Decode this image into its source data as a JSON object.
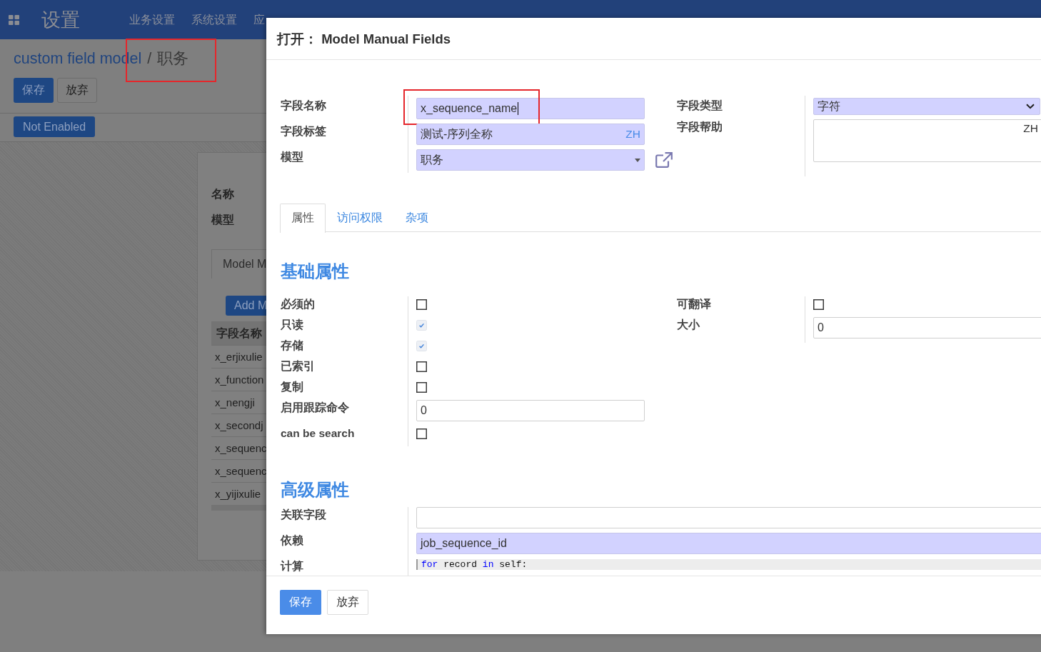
{
  "topbar": {
    "brand": "设置",
    "menu": [
      "业务设置",
      "系统设置",
      "应"
    ]
  },
  "background_page": {
    "breadcrumb": [
      {
        "label": "custom field model",
        "link": true,
        "highlighted": false
      },
      {
        "label": "职务",
        "link": false,
        "highlighted": true
      }
    ],
    "breadcrumb_separator": "/",
    "buttons": [
      {
        "label": "保存",
        "kind": "primary"
      },
      {
        "label": "放弃",
        "kind": "secondary"
      }
    ],
    "status_button": "Not Enabled",
    "sheet": {
      "fields": [
        "名称",
        "模型"
      ],
      "tabs": [
        {
          "label": "Model M",
          "selected": true
        }
      ],
      "add_button": "Add M",
      "table": {
        "columns": [
          "字段名称"
        ],
        "rows": [
          [
            "x_erjixulie"
          ],
          [
            "x_function"
          ],
          [
            "x_nengji"
          ],
          [
            "x_secondj"
          ],
          [
            "x_sequenc"
          ],
          [
            "x_sequenc"
          ],
          [
            "x_yijixulie"
          ]
        ]
      }
    }
  },
  "dialog": {
    "title": "打开： Model Manual Fields",
    "header_fields": {
      "left": [
        {
          "label": "字段名称",
          "kind": "text",
          "value": "x_sequence_name",
          "required": true,
          "focused": true,
          "highlighted": true
        },
        {
          "label": "字段标签",
          "kind": "translatable",
          "value": "测试-序列全称",
          "lang": "ZH",
          "required": true,
          "focused": false,
          "highlighted": false
        },
        {
          "label": "模型",
          "kind": "many2one",
          "value": "职务",
          "required": true,
          "focused": false,
          "highlighted": false
        }
      ],
      "right": [
        {
          "label": "字段类型",
          "kind": "select",
          "value": "字符",
          "required": true
        },
        {
          "label": "字段帮助",
          "kind": "textarea",
          "lang": "ZH",
          "required": false
        }
      ]
    },
    "tabs": [
      {
        "label": "属性",
        "selected": true
      },
      {
        "label": "访问权限",
        "selected": false
      },
      {
        "label": "杂项",
        "selected": false
      }
    ],
    "basic": {
      "title": "基础属性",
      "left": [
        {
          "label": "必须的",
          "kind": "checkbox",
          "checked": false
        },
        {
          "label": "只读",
          "kind": "checkbox",
          "checked": true
        },
        {
          "label": "存储",
          "kind": "checkbox",
          "checked": true
        },
        {
          "label": "已索引",
          "kind": "checkbox",
          "checked": false
        },
        {
          "label": "复制",
          "kind": "checkbox",
          "checked": false
        },
        {
          "label": "启用跟踪命令",
          "kind": "input",
          "value": "0",
          "required": false
        },
        {
          "label": "can be search",
          "kind": "checkbox",
          "checked": false
        }
      ],
      "right": [
        {
          "label": "可翻译",
          "kind": "checkbox",
          "checked": false
        },
        {
          "label": "大小",
          "kind": "input",
          "value": "0",
          "required": false
        }
      ]
    },
    "advanced": {
      "title": "高级属性",
      "rows": [
        {
          "label": "关联字段",
          "kind": "input",
          "required": false
        },
        {
          "label": "依赖",
          "kind": "input",
          "value": "job_sequence_id",
          "required": true
        },
        {
          "label": "计算",
          "kind": "code",
          "lines": [
            {
              "active": true,
              "tokens": [
                {
                  "text": "for",
                  "kind": "keyword"
                },
                {
                  "text": " record ",
                  "kind": "name"
                },
                {
                  "text": "in",
                  "kind": "keyword"
                },
                {
                  "text": " self:",
                  "kind": "name"
                }
              ]
            }
          ]
        }
      ]
    },
    "buttons": [
      {
        "label": "保存",
        "kind": "primary"
      },
      {
        "label": "放弃",
        "kind": "secondary"
      }
    ]
  }
}
